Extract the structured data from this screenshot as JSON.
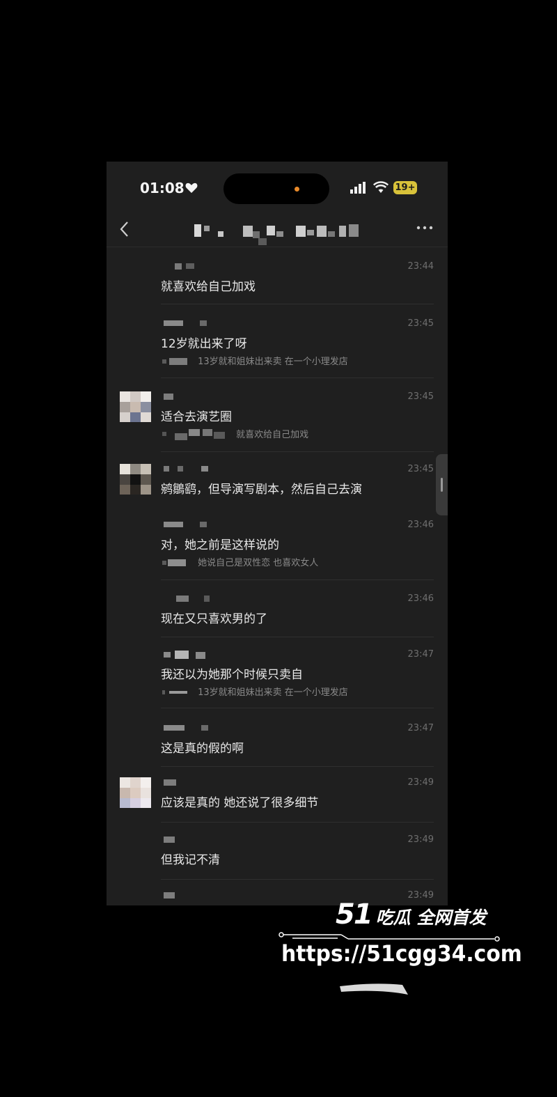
{
  "status_bar": {
    "time": "01:08",
    "battery_badge": "19+"
  },
  "messages": [
    {
      "time": "23:44",
      "text": "就喜欢给自己加戏",
      "reply": "",
      "avatar": false
    },
    {
      "time": "23:45",
      "text": "12岁就出来了呀",
      "reply": "13岁就和姐妹出来卖 在一个小理发店",
      "avatar": false
    },
    {
      "time": "23:45",
      "text": "适合去演艺圈",
      "reply": "就喜欢给自己加戏",
      "avatar": true
    },
    {
      "time": "23:45",
      "text": "鹓鶵鹞，但导演写剧本，然后自己去演",
      "reply": "",
      "avatar": true
    },
    {
      "time": "23:46",
      "text": "对，她之前是这样说的",
      "reply": "她说自己是双性恋 也喜欢女人",
      "avatar": false
    },
    {
      "time": "23:46",
      "text": "现在又只喜欢男的了",
      "reply": "",
      "avatar": false
    },
    {
      "time": "23:47",
      "text": "我还以为她那个时候只卖自",
      "reply": "13岁就和姐妹出来卖 在一个小理发店",
      "avatar": false
    },
    {
      "time": "23:47",
      "text": "这是真的假的啊",
      "reply": "",
      "avatar": false
    },
    {
      "time": "23:49",
      "text": "应该是真的 她还说了很多细节",
      "reply": "",
      "avatar": true
    },
    {
      "time": "23:49",
      "text": "但我记不清",
      "reply": "",
      "avatar": false
    },
    {
      "time": "23:49",
      "text": "",
      "reply": "",
      "avatar": false
    }
  ],
  "watermark": {
    "brand_number": "51",
    "brand_tagline": "吃瓜 全网首发",
    "url": "https://51cgg34.com"
  },
  "colors": {
    "background": "#000000",
    "screen": "#1f1f1f",
    "message_text": "#e9e9e9",
    "timestamp": "#6f6f6f",
    "reply_text": "#8a8a8a",
    "battery_badge": "#d8c23a",
    "island_dot": "#e98a2a"
  }
}
